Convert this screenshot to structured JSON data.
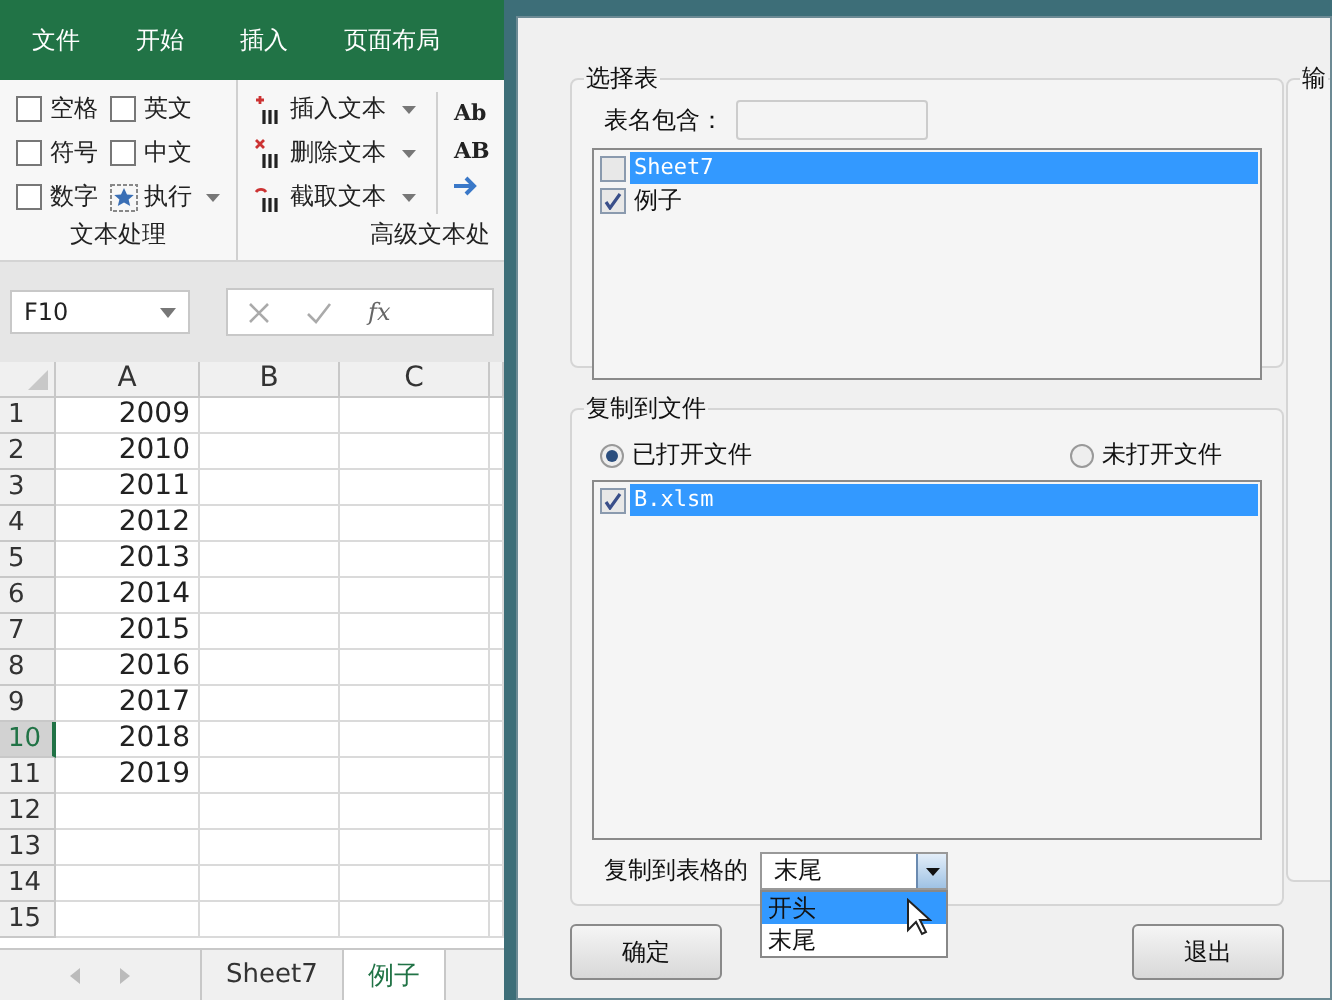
{
  "excel": {
    "menu_tabs": [
      "文件",
      "开始",
      "插入",
      "页面布局"
    ],
    "text_group": {
      "label": "文本处理",
      "checkboxes": [
        {
          "label": "空格",
          "checked": false
        },
        {
          "label": "英文",
          "checked": false
        },
        {
          "label": "符号",
          "checked": false
        },
        {
          "label": "中文",
          "checked": false
        },
        {
          "label": "数字",
          "checked": false
        }
      ],
      "run_button": "执行"
    },
    "advanced_group": {
      "label": "高级文本处",
      "buttons": [
        "插入文本",
        "删除文本",
        "截取文本"
      ],
      "side_icons": [
        "Ab",
        "AB"
      ]
    },
    "name_box": "F10",
    "function_label": "fx",
    "columns": [
      "A",
      "B",
      "C"
    ],
    "rows": [
      {
        "label": "1",
        "a": "2009",
        "selected": false
      },
      {
        "label": "2",
        "a": "2010",
        "selected": false
      },
      {
        "label": "3",
        "a": "2011",
        "selected": false
      },
      {
        "label": "4",
        "a": "2012",
        "selected": false
      },
      {
        "label": "5",
        "a": "2013",
        "selected": false
      },
      {
        "label": "6",
        "a": "2014",
        "selected": false
      },
      {
        "label": "7",
        "a": "2015",
        "selected": false
      },
      {
        "label": "8",
        "a": "2016",
        "selected": false
      },
      {
        "label": "9",
        "a": "2017",
        "selected": false
      },
      {
        "label": "10",
        "a": "2018",
        "selected": true
      },
      {
        "label": "11",
        "a": "2019",
        "selected": false
      },
      {
        "label": "12",
        "selected": false
      },
      {
        "label": "13",
        "selected": false
      },
      {
        "label": "14",
        "selected": false
      },
      {
        "label": "15",
        "selected": false
      }
    ],
    "sheet_tabs": [
      {
        "label": "Sheet7",
        "selected": false
      },
      {
        "label": "例子",
        "selected": true
      }
    ]
  },
  "dialog": {
    "select_group": {
      "title": "选择表",
      "filter_label": "表名包含：",
      "sheets": [
        {
          "label": "Sheet7",
          "checked": false,
          "selected": true
        },
        {
          "label": "例子",
          "checked": true,
          "selected": false
        }
      ]
    },
    "copy_group": {
      "title": "复制到文件",
      "radios": [
        {
          "label": "已打开文件",
          "selected": true
        },
        {
          "label": "未打开文件",
          "selected": false
        }
      ],
      "files": [
        {
          "label": "B.xlsm",
          "checked": true,
          "selected": true
        }
      ],
      "position_label": "复制到表格的",
      "position_value": "末尾",
      "options": [
        {
          "label": "开头",
          "selected": true
        },
        {
          "label": "末尾",
          "selected": false
        }
      ]
    },
    "output_title": "输",
    "buttons": [
      "确定",
      "退出"
    ]
  }
}
